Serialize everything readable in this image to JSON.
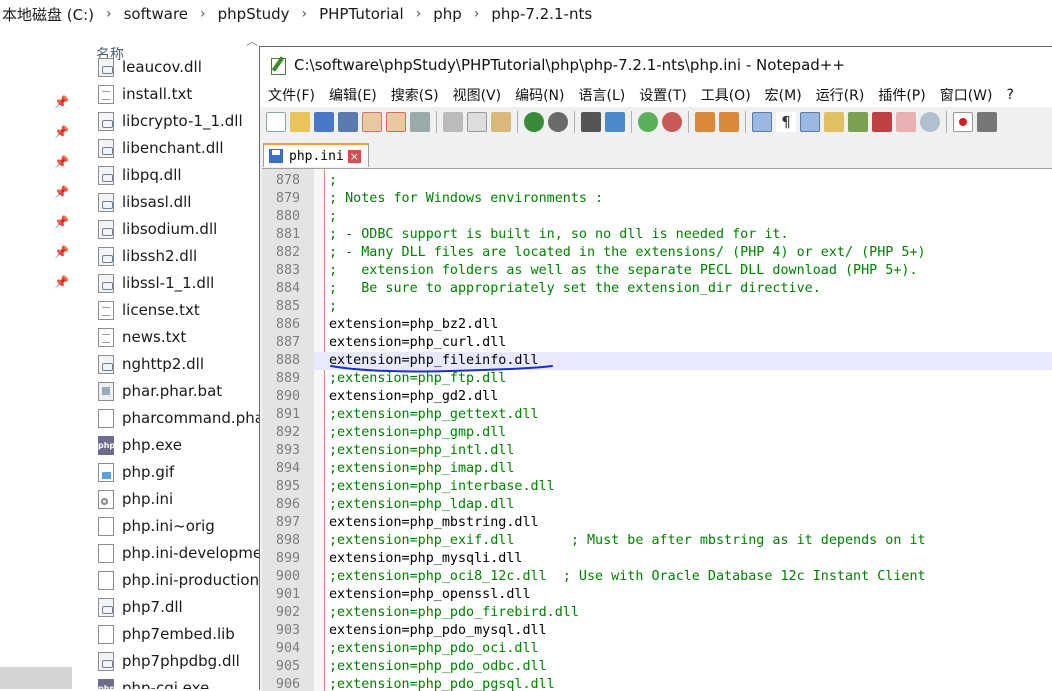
{
  "explorer": {
    "breadcrumb": [
      "本地磁盘 (C:)",
      "software",
      "phpStudy",
      "PHPTutorial",
      "php",
      "php-7.2.1-nts"
    ],
    "column_header": "名称",
    "files": [
      {
        "name": "leaucov.dll",
        "icon": "dll-file-icon"
      },
      {
        "name": "install.txt",
        "icon": "text-file-icon"
      },
      {
        "name": "libcrypto-1_1.dll",
        "icon": "dll-file-icon"
      },
      {
        "name": "libenchant.dll",
        "icon": "dll-file-icon"
      },
      {
        "name": "libpq.dll",
        "icon": "dll-file-icon"
      },
      {
        "name": "libsasl.dll",
        "icon": "dll-file-icon"
      },
      {
        "name": "libsodium.dll",
        "icon": "dll-file-icon"
      },
      {
        "name": "libssh2.dll",
        "icon": "dll-file-icon"
      },
      {
        "name": "libssl-1_1.dll",
        "icon": "dll-file-icon"
      },
      {
        "name": "license.txt",
        "icon": "text-file-icon"
      },
      {
        "name": "news.txt",
        "icon": "text-file-icon"
      },
      {
        "name": "nghttp2.dll",
        "icon": "dll-file-icon"
      },
      {
        "name": "phar.phar.bat",
        "icon": "batch-file-icon"
      },
      {
        "name": "pharcommand.phar",
        "icon": "blank-file-icon"
      },
      {
        "name": "php.exe",
        "icon": "php-exe-icon"
      },
      {
        "name": "php.gif",
        "icon": "gif-image-icon"
      },
      {
        "name": "php.ini",
        "icon": "ini-settings-icon"
      },
      {
        "name": "php.ini~orig",
        "icon": "blank-file-icon"
      },
      {
        "name": "php.ini-development",
        "icon": "blank-file-icon"
      },
      {
        "name": "php.ini-production",
        "icon": "blank-file-icon"
      },
      {
        "name": "php7.dll",
        "icon": "dll-file-icon"
      },
      {
        "name": "php7embed.lib",
        "icon": "blank-file-icon"
      },
      {
        "name": "php7phpdbg.dll",
        "icon": "dll-file-icon"
      },
      {
        "name": "php-cgi.exe",
        "icon": "php-exe-icon"
      }
    ]
  },
  "notepad": {
    "title": "C:\\software\\phpStudy\\PHPTutorial\\php\\php-7.2.1-nts\\php.ini - Notepad++",
    "menu": [
      "文件(F)",
      "编辑(E)",
      "搜索(S)",
      "视图(V)",
      "编码(N)",
      "语言(L)",
      "设置(T)",
      "工具(O)",
      "宏(M)",
      "运行(R)",
      "插件(P)",
      "窗口(W)",
      "?"
    ],
    "tab_label": "php.ini",
    "current_line": 888,
    "lines": [
      {
        "num": "878",
        "text": ";",
        "type": "comment"
      },
      {
        "num": "879",
        "text": "; Notes for Windows environments :",
        "type": "comment"
      },
      {
        "num": "880",
        "text": ";",
        "type": "comment"
      },
      {
        "num": "881",
        "text": "; - ODBC support is built in, so no dll is needed for it.",
        "type": "comment"
      },
      {
        "num": "882",
        "text": "; - Many DLL files are located in the extensions/ (PHP 4) or ext/ (PHP 5+)",
        "type": "comment"
      },
      {
        "num": "883",
        "text": ";   extension folders as well as the separate PECL DLL download (PHP 5+).",
        "type": "comment"
      },
      {
        "num": "884",
        "text": ";   Be sure to appropriately set the extension_dir directive.",
        "type": "comment"
      },
      {
        "num": "885",
        "text": ";",
        "type": "comment"
      },
      {
        "num": "886",
        "text": "extension=php_bz2.dll",
        "type": "setting"
      },
      {
        "num": "887",
        "text": "extension=php_curl.dll",
        "type": "setting"
      },
      {
        "num": "888",
        "text": "extension=php_fileinfo.dll",
        "type": "setting"
      },
      {
        "num": "889",
        "text": ";extension=php_ftp.dll",
        "type": "comment"
      },
      {
        "num": "890",
        "text": "extension=php_gd2.dll",
        "type": "setting"
      },
      {
        "num": "891",
        "text": ";extension=php_gettext.dll",
        "type": "comment"
      },
      {
        "num": "892",
        "text": ";extension=php_gmp.dll",
        "type": "comment"
      },
      {
        "num": "893",
        "text": ";extension=php_intl.dll",
        "type": "comment"
      },
      {
        "num": "894",
        "text": ";extension=php_imap.dll",
        "type": "comment"
      },
      {
        "num": "895",
        "text": ";extension=php_interbase.dll",
        "type": "comment"
      },
      {
        "num": "896",
        "text": ";extension=php_ldap.dll",
        "type": "comment"
      },
      {
        "num": "897",
        "text": "extension=php_mbstring.dll",
        "type": "setting"
      },
      {
        "num": "898",
        "text": ";extension=php_exif.dll       ; Must be after mbstring as it depends on it",
        "type": "comment"
      },
      {
        "num": "899",
        "text": "extension=php_mysqli.dll",
        "type": "setting"
      },
      {
        "num": "900",
        "text": ";extension=php_oci8_12c.dll  ; Use with Oracle Database 12c Instant Client",
        "type": "comment"
      },
      {
        "num": "901",
        "text": "extension=php_openssl.dll",
        "type": "setting"
      },
      {
        "num": "902",
        "text": ";extension=php_pdo_firebird.dll",
        "type": "comment"
      },
      {
        "num": "903",
        "text": "extension=php_pdo_mysql.dll",
        "type": "setting"
      },
      {
        "num": "904",
        "text": ";extension=php_pdo_oci.dll",
        "type": "comment"
      },
      {
        "num": "905",
        "text": ";extension=php_pdo_odbc.dll",
        "type": "comment"
      },
      {
        "num": "906",
        "text": ";extension=php_pdo_pgsql.dll",
        "type": "comment"
      }
    ]
  },
  "colors": {
    "comment": "#008000",
    "current_line_bg": "#e8e8ff",
    "annotation_ink": "#1a2fc4",
    "tab_accent": "#f2a23c"
  }
}
